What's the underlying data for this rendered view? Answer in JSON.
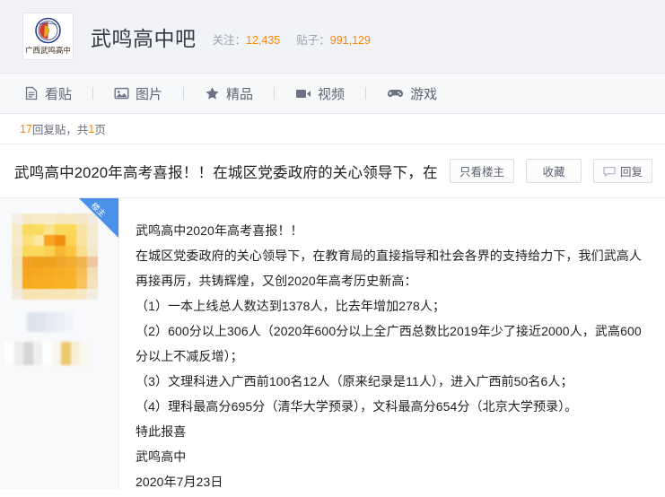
{
  "header": {
    "forum_name": "武鸣高中吧",
    "logo_alt": "广西武鸣高中",
    "stats": [
      {
        "label": "关注：",
        "value": "12,435"
      },
      {
        "label": "贴子：",
        "value": "991,129"
      }
    ],
    "accent_orange": "#ff8400",
    "background": "#f2f3f7"
  },
  "nav": {
    "items": [
      {
        "label": "看贴",
        "icon": "document-icon"
      },
      {
        "label": "图片",
        "icon": "image-icon"
      },
      {
        "label": "精品",
        "icon": "star-icon"
      },
      {
        "label": "视频",
        "icon": "video-icon"
      },
      {
        "label": "游戏",
        "icon": "gamepad-icon"
      }
    ]
  },
  "reply_strip": {
    "count": "17",
    "middle": " 回复贴，共",
    "pages": "1",
    "suffix": "页"
  },
  "thread": {
    "title": "武鸣高中2020年高考喜报！！在城区党委政府的关心领导下，在",
    "buttons": [
      {
        "label": "只看楼主",
        "icon": ""
      },
      {
        "label": "收藏",
        "icon": ""
      },
      {
        "label": "回复",
        "icon": "comment-icon"
      }
    ]
  },
  "post": {
    "badge": "楼主",
    "badge_color": "#4a90e8",
    "lines": [
      "武鸣高中2020年高考喜报！！",
      "在城区党委政府的关心领导下，在教育局的直接指导和社会各界的支持给力下，我们武高人再接再厉，共铸辉煌，又创2020年高考历史新高：",
      "（1）一本上线总人数达到1378人，比去年增加278人；",
      "（2）600分以上306人（2020年600分以上全广西总数比2019年少了接近2000人，武高600分以上不减反增）；",
      "（3）文理科进入广西前100名12人（原来纪录是11人），进入广西前50名6人；",
      "（4）理科最高分695分（清华大学预录），文科最高分654分（北京大学预录）。",
      "特此报喜",
      "武鸣高中",
      "2020年7月23日"
    ]
  }
}
